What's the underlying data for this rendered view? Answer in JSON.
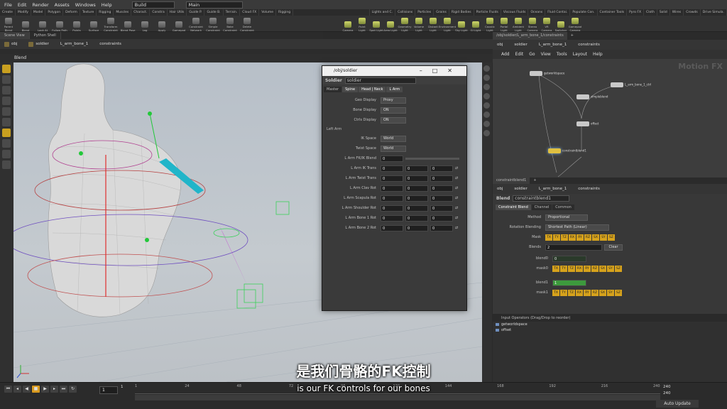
{
  "menu": {
    "items": [
      "File",
      "Edit",
      "Render",
      "Assets",
      "Windows",
      "Help"
    ],
    "desktop": "Build",
    "main": "Main"
  },
  "shelf": {
    "tabs_left": [
      "Create",
      "Modify",
      "Model",
      "Polygon",
      "Deform",
      "Texture",
      "Rigging",
      "Muscles",
      "Charact.",
      "Constra",
      "Hair Utils",
      "Guide P.",
      "Guide B.",
      "Terrain.",
      "Cloud FX",
      "Volume",
      "Rigging"
    ],
    "tabs_right": [
      "Lights and C.",
      "Collisions",
      "Particles",
      "Grains",
      "Rigid Bodies",
      "Particle Fluids",
      "Viscous Fluids",
      "Oceans",
      "Fluid Contai.",
      "Populate Con.",
      "Container Tools",
      "Pyro FX",
      "Cloth",
      "Solid",
      "Wires",
      "Crowds",
      "Drive Simula."
    ],
    "tools_left": [
      "Parent Blend",
      "Blend",
      "Look At",
      "Follow Path",
      "Points",
      "Surface",
      "Transform Constraint",
      "Blend Pose",
      "Lag",
      "Apply",
      "Gamepad",
      "Constraint Network",
      "Simple Constraint",
      "Bake Constraint",
      "Delete Constraint"
    ],
    "tools_right": [
      "Camera",
      "Point Light",
      "Spot Light",
      "Area Light",
      "Geometry Light",
      "Volume Light",
      "Distant Light",
      "Environment Light",
      "Sky Light",
      "GI Light",
      "Caustic Light",
      "Portal Light",
      "Ambient Light",
      "Stereo Camera",
      "VR Camera",
      "Switcher",
      "Gamepad Camera"
    ]
  },
  "left_tabs": [
    "Scene View",
    "Python Shell"
  ],
  "left_path": [
    "obj",
    "soldier",
    "L_arm_bone_1",
    "constraints"
  ],
  "viewport_title": "Blend",
  "soldier_window": {
    "title": "/obj/soldier",
    "op_label": "Soldier",
    "name": "soldier",
    "tabs": [
      "Master",
      "Spine",
      "Head | Neck",
      "L Arm"
    ],
    "rows_top": [
      {
        "label": "Geo Display",
        "value": "Proxy"
      },
      {
        "label": "Bone Display",
        "value": "ON"
      },
      {
        "label": "Ctrls Display",
        "value": "ON"
      }
    ],
    "section": "Left Arm",
    "rows_space": [
      {
        "label": "IK Space",
        "value": "World"
      },
      {
        "label": "Twist Space",
        "value": "World"
      }
    ],
    "fkik_label": "L Arm FK/IK Blend",
    "fkik_value": "0",
    "rows_vec": [
      {
        "label": "L Arm IK Trans",
        "v": [
          "0",
          "0",
          "0"
        ]
      },
      {
        "label": "L Arm Twist Trans",
        "v": [
          "0",
          "0",
          "0"
        ]
      },
      {
        "label": "L Arm Clav Rot",
        "v": [
          "0",
          "0",
          "0"
        ]
      },
      {
        "label": "L Arm Scapula Rot",
        "v": [
          "0",
          "0",
          "0"
        ]
      },
      {
        "label": "L Arm Shoulder Rot",
        "v": [
          "0",
          "0",
          "0"
        ]
      },
      {
        "label": "L Arm Bone 1 Rot",
        "v": [
          "0",
          "0",
          "0"
        ]
      },
      {
        "label": "L Arm Bone 2 Rot",
        "v": [
          "0",
          "0",
          "0"
        ]
      }
    ]
  },
  "network": {
    "tabs": [
      "/obj/soldier/L_arm_bone_1/constraints",
      "+"
    ],
    "menu": [
      "Add",
      "Edit",
      "Go",
      "View",
      "Tools",
      "Layout",
      "Help"
    ],
    "path": [
      "obj",
      "soldier",
      "L_arm_bone_1",
      "constraints"
    ],
    "watermark": "Motion FX",
    "nodes": [
      "getworldspace",
      "L_arm_bone_1_ctrl",
      "simpleblend",
      "offset",
      "constraintblend1"
    ]
  },
  "params": {
    "tabs": [
      "constraintblend1",
      "+"
    ],
    "path": [
      "obj",
      "soldier",
      "L_arm_bone_1",
      "constraints"
    ],
    "op_label": "Blend",
    "name": "constraintblend1",
    "ptabs": [
      "Constraint Blend",
      "Channel",
      "Common"
    ],
    "method_label": "Method",
    "method": "Proportional",
    "rot_label": "Rotation Blending",
    "rot": "Shortest Path (Linear)",
    "mask_label": "Mask",
    "mask": [
      "TX",
      "TY",
      "TZ",
      "RX",
      "RY",
      "RZ",
      "SX",
      "SY",
      "SZ"
    ],
    "blends_label": "Blends",
    "blends": "2",
    "clear": "Clear",
    "blend0_label": "blend0",
    "blend0": "0",
    "mask0_label": "mask0",
    "blend1_label": "blend1",
    "blend1": "1",
    "mask1_label": "mask1"
  },
  "inputs": {
    "header": "Input Operators (Drag/Drop to reorder)",
    "items": [
      "getworldspace",
      "offset"
    ]
  },
  "timeline": {
    "frame": "1",
    "start": "1",
    "ticks": [
      "1",
      "24",
      "48",
      "72",
      "96",
      "120",
      "144",
      "168",
      "192",
      "216",
      "240"
    ],
    "end1": "240",
    "end2": "240",
    "auto_update": "Auto Update"
  },
  "subtitle": {
    "zh": "是我们骨骼的FK控制",
    "en": "is our FK controls for our bones"
  }
}
